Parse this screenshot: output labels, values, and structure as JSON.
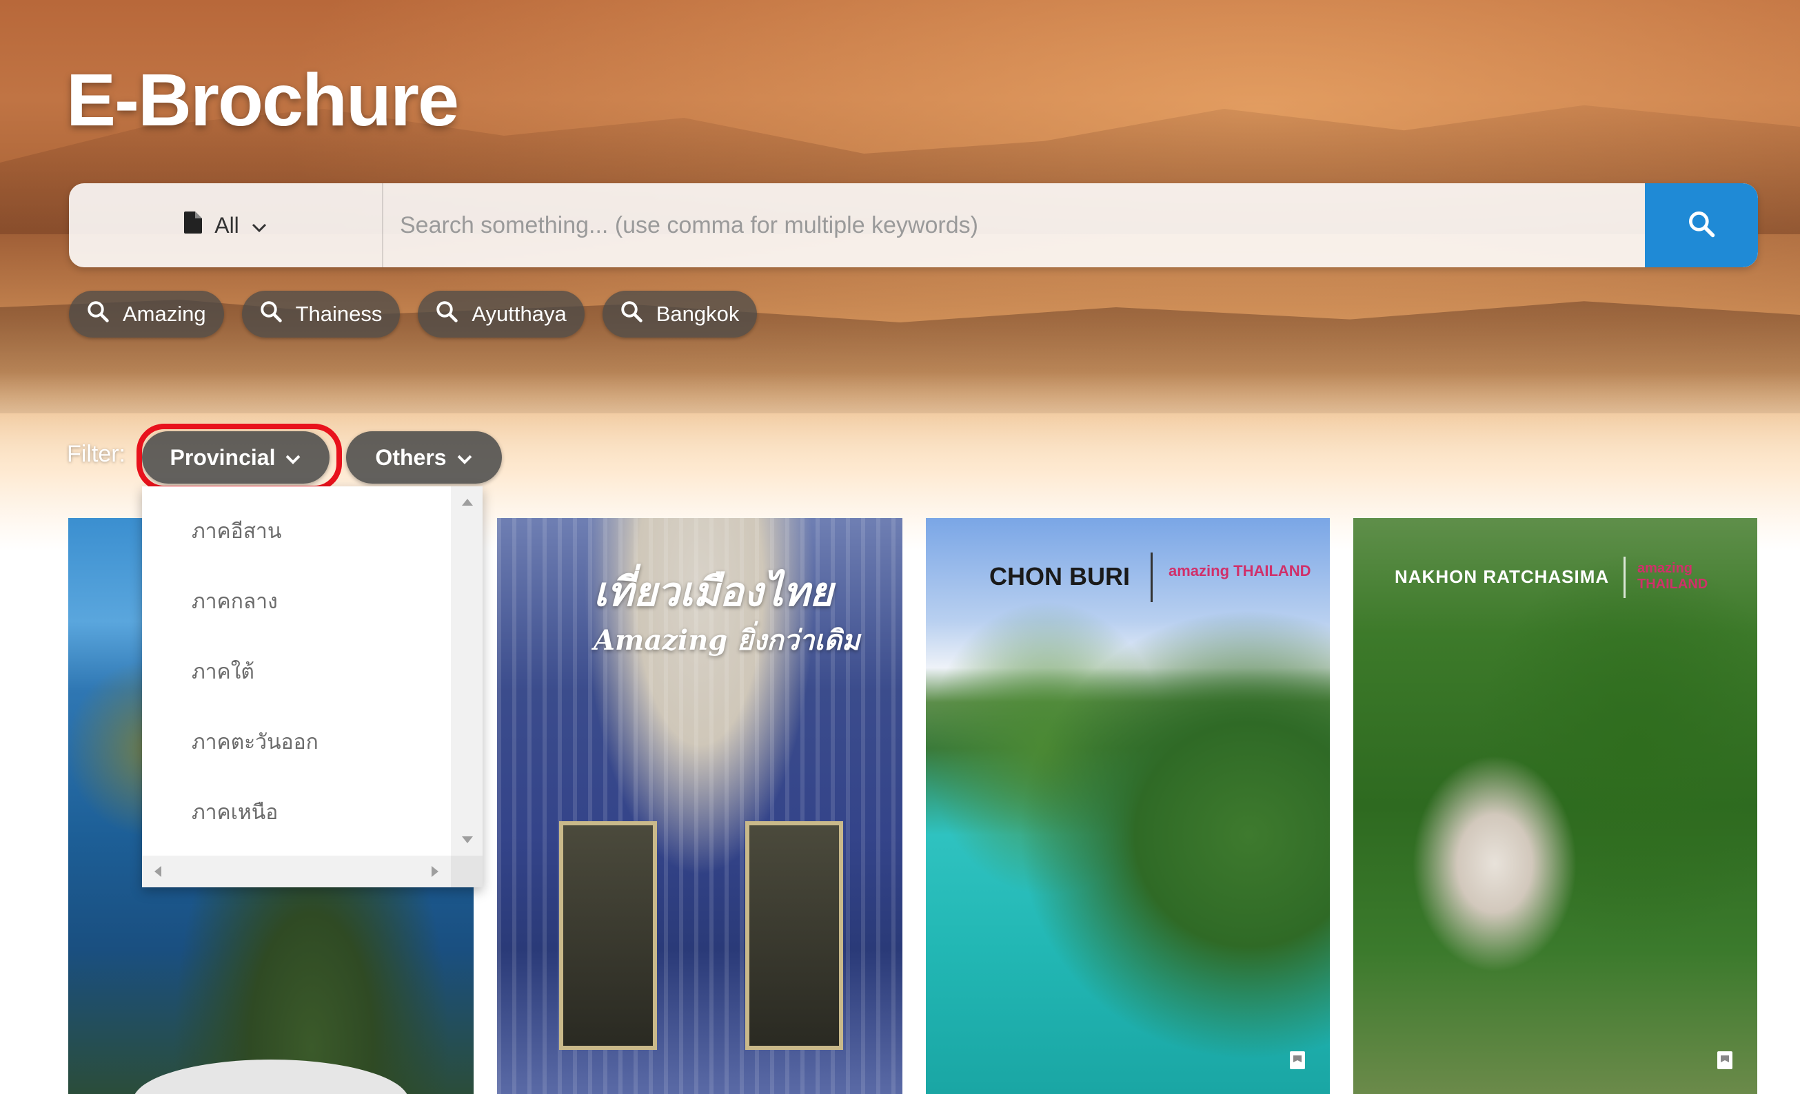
{
  "page": {
    "title": "E-Brochure"
  },
  "search": {
    "type_selected": "All",
    "placeholder": "Search something... (use comma for multiple keywords)",
    "value": "",
    "button_icon": "search-icon"
  },
  "quick_tags": [
    {
      "label": "Amazing",
      "icon": "search-icon"
    },
    {
      "label": "Thainess",
      "icon": "search-icon"
    },
    {
      "label": "Ayutthaya",
      "icon": "search-icon"
    },
    {
      "label": "Bangkok",
      "icon": "search-icon"
    }
  ],
  "filter": {
    "label": "Filter:",
    "provincial": "Provincial",
    "others": "Others",
    "highlight_color": "#e8121c",
    "dropdown_items": [
      "ภาคอีสาน",
      "ภาคกลาง",
      "ภาคใต้",
      "ภาคตะวันออก",
      "ภาคเหนือ"
    ]
  },
  "cards": [
    {
      "overlay": []
    },
    {
      "title": "เที่ยวเมืองไทย",
      "subtitle": "Amazing ยิ่งกว่าเดิม"
    },
    {
      "place": "CHON BURI",
      "brand": "amazing THAILAND"
    },
    {
      "place": "NAKHON RATCHASIMA",
      "brand": "amazing THAILAND"
    }
  ],
  "colors": {
    "accent_blue": "#1f8ad6",
    "chip_bg": "#464848"
  }
}
